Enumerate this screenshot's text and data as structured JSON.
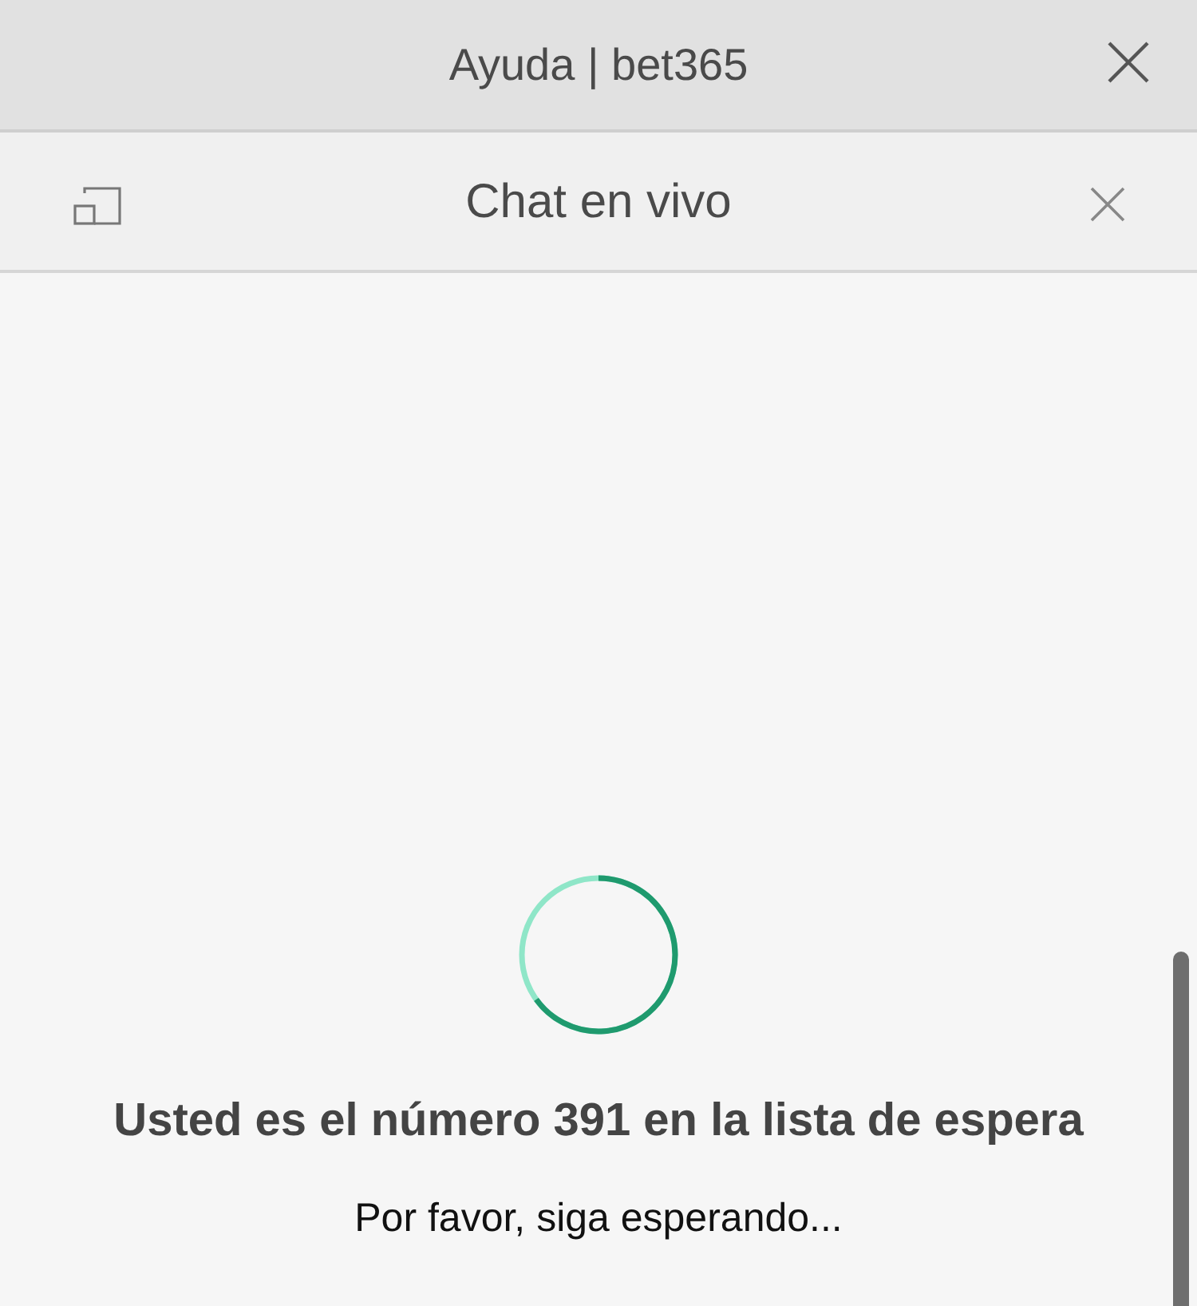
{
  "window": {
    "title": "Ayuda | bet365"
  },
  "chat_header": {
    "title": "Chat en vivo"
  },
  "queue": {
    "message": "Usted es el número 391 en la lista de espera",
    "subtext": "Por favor, siga esperando..."
  }
}
